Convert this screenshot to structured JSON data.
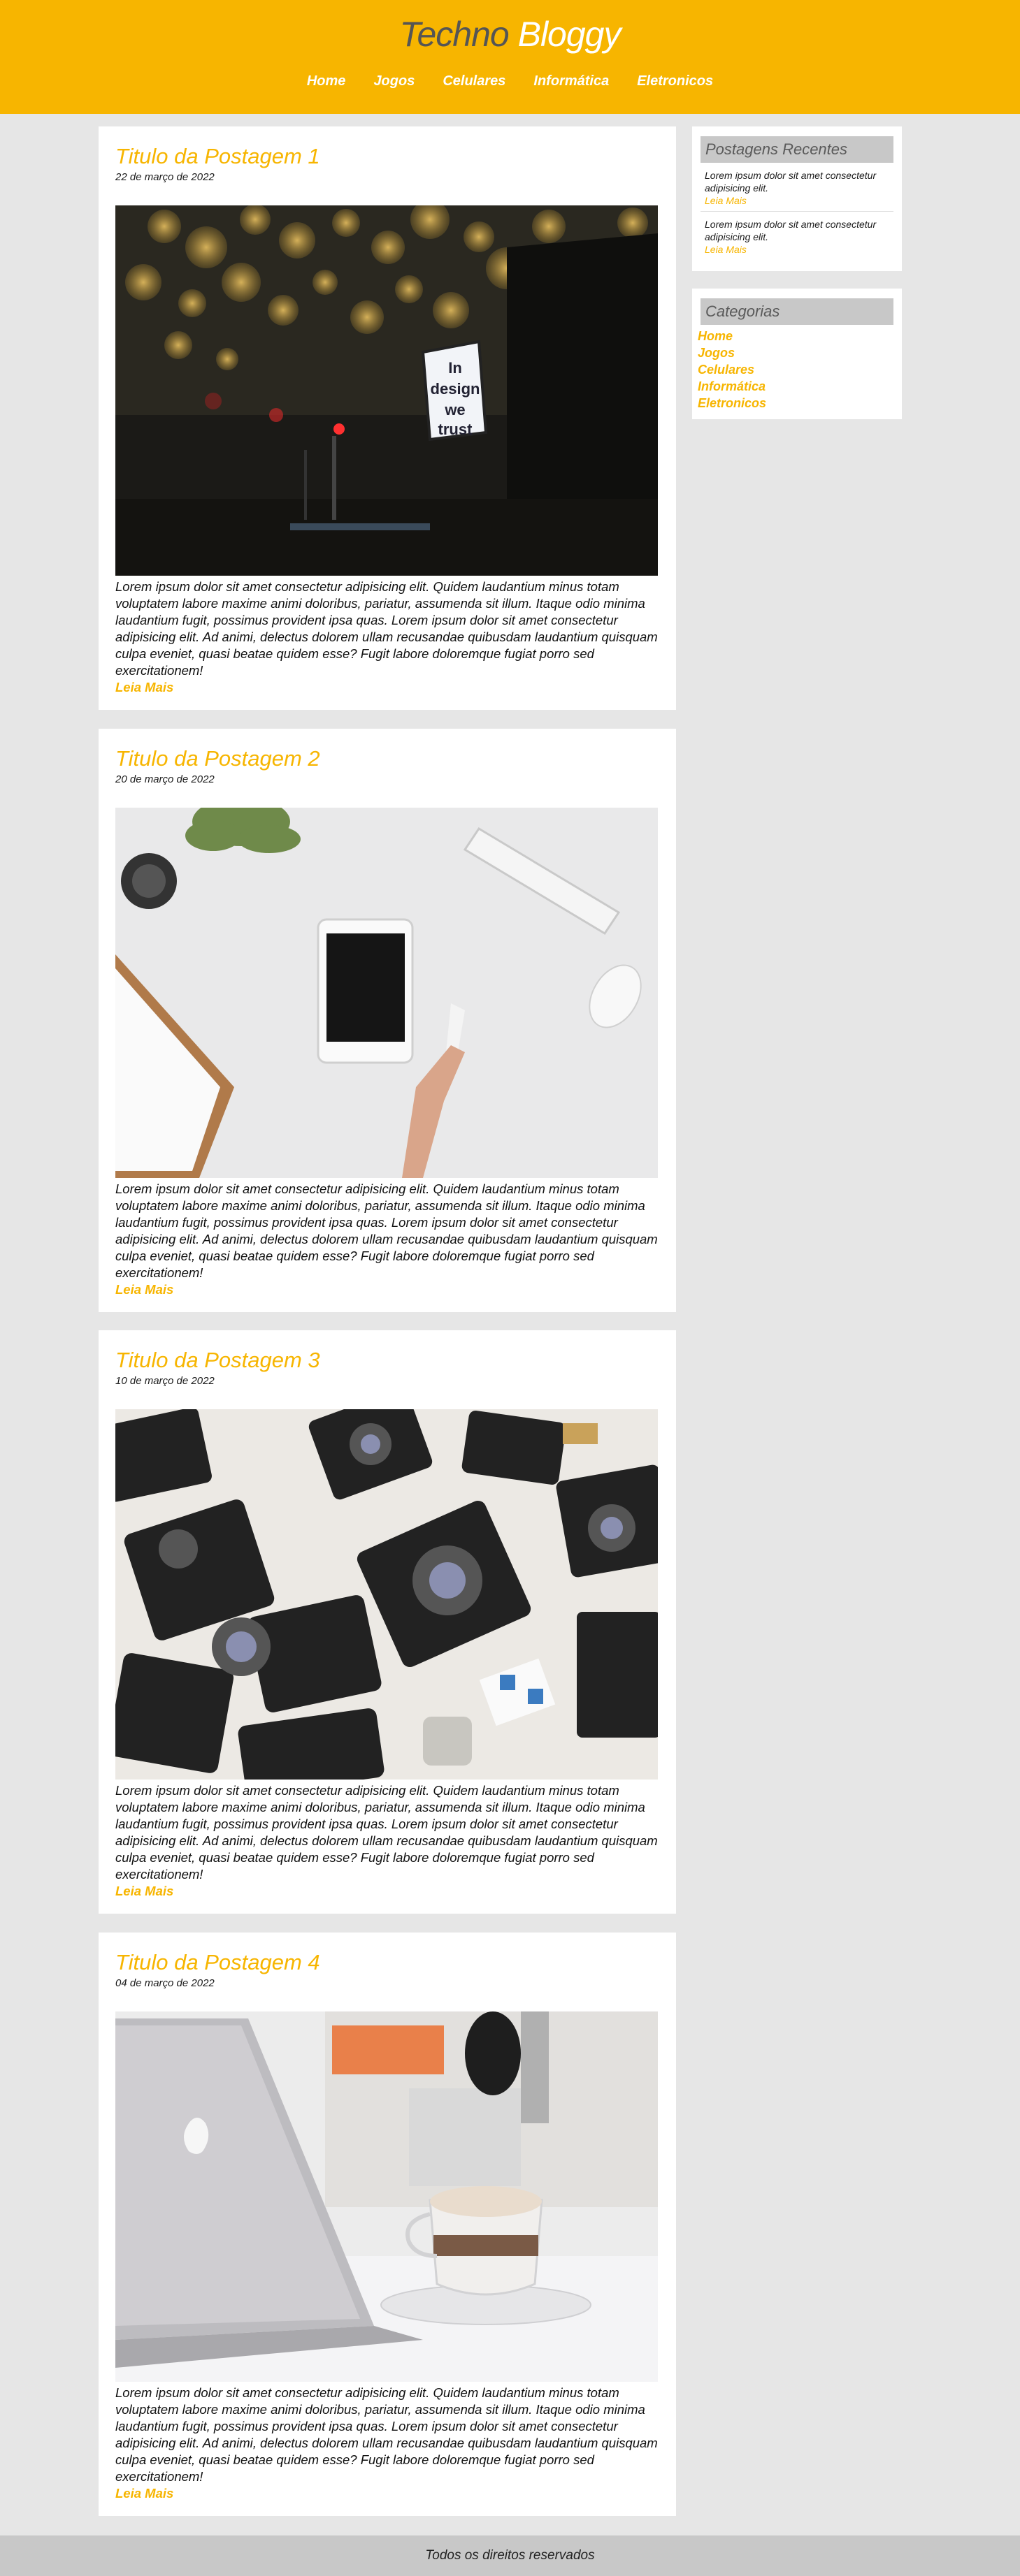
{
  "header": {
    "logo_part1": "Techno",
    "logo_part2": "Bloggy",
    "nav": [
      "Home",
      "Jogos",
      "Celulares",
      "Informática",
      "Eletronicos"
    ]
  },
  "posts": [
    {
      "title": "Titulo da Postagem 1",
      "date": "22 de março de 2022",
      "image_sign": [
        "In",
        "design",
        "we",
        "trust"
      ],
      "body": "Lorem ipsum dolor sit amet consectetur adipisicing elit. Quidem laudantium minus totam voluptatem labore maxime animi doloribus, pariatur, assumenda sit illum. Itaque odio minima laudantium fugit, possimus provident ipsa quas. Lorem ipsum dolor sit amet consectetur adipisicing elit. Ad animi, delectus dolorem ullam recusandae quibusdam laudantium quisquam culpa eveniet, quasi beatae quidem esse? Fugit labore doloremque fugiat porro sed exercitationem!",
      "more": "Leia Mais"
    },
    {
      "title": "Titulo da Postagem 2",
      "date": "20 de março de 2022",
      "body": "Lorem ipsum dolor sit amet consectetur adipisicing elit. Quidem laudantium minus totam voluptatem labore maxime animi doloribus, pariatur, assumenda sit illum. Itaque odio minima laudantium fugit, possimus provident ipsa quas. Lorem ipsum dolor sit amet consectetur adipisicing elit. Ad animi, delectus dolorem ullam recusandae quibusdam laudantium quisquam culpa eveniet, quasi beatae quidem esse? Fugit labore doloremque fugiat porro sed exercitationem!",
      "more": "Leia Mais"
    },
    {
      "title": "Titulo da Postagem 3",
      "date": "10 de março de 2022",
      "body": "Lorem ipsum dolor sit amet consectetur adipisicing elit. Quidem laudantium minus totam voluptatem labore maxime animi doloribus, pariatur, assumenda sit illum. Itaque odio minima laudantium fugit, possimus provident ipsa quas. Lorem ipsum dolor sit amet consectetur adipisicing elit. Ad animi, delectus dolorem ullam recusandae quibusdam laudantium quisquam culpa eveniet, quasi beatae quidem esse? Fugit labore doloremque fugiat porro sed exercitationem!",
      "more": "Leia Mais"
    },
    {
      "title": "Titulo da Postagem 4",
      "date": "04 de março de 2022",
      "body": "Lorem ipsum dolor sit amet consectetur adipisicing elit. Quidem laudantium minus totam voluptatem labore maxime animi doloribus, pariatur, assumenda sit illum. Itaque odio minima laudantium fugit, possimus provident ipsa quas. Lorem ipsum dolor sit amet consectetur adipisicing elit. Ad animi, delectus dolorem ullam recusandae quibusdam laudantium quisquam culpa eveniet, quasi beatae quidem esse? Fugit labore doloremque fugiat porro sed exercitationem!",
      "more": "Leia Mais"
    }
  ],
  "sidebar": {
    "recent_title": "Postagens Recentes",
    "recent": [
      {
        "text": "Lorem ipsum dolor sit amet consectetur adipisicing elit.",
        "more": "Leia Mais"
      },
      {
        "text": "Lorem ipsum dolor sit amet consectetur adipisicing elit.",
        "more": "Leia Mais"
      }
    ],
    "categories_title": "Categorias",
    "categories": [
      "Home",
      "Jogos",
      "Celulares",
      "Informática",
      "Eletronicos"
    ]
  },
  "footer": {
    "text": "Todos os direitos reservados"
  },
  "colors": {
    "accent": "#f7b500",
    "background": "#e6e6e6",
    "widget_header": "#c8c8c8"
  }
}
